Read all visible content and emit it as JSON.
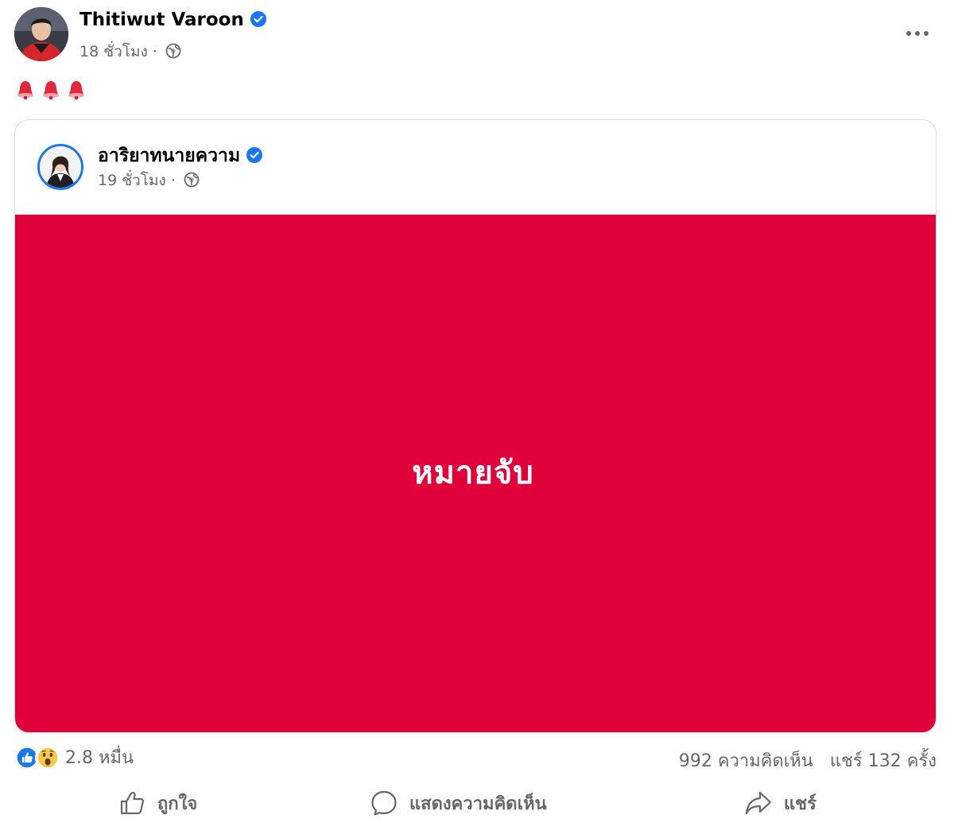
{
  "post": {
    "author_name": "Thitiwut Varoon",
    "time": "18 ชั่วโมง",
    "separator": "·",
    "caption_icons": [
      "red-bell-icon",
      "red-bell-icon",
      "red-bell-icon"
    ]
  },
  "shared": {
    "author_name": "อาริยาทนายความ",
    "time": "19 ชั่วโมง",
    "separator": "·",
    "banner_text": "หมายจับ",
    "banner_color": "#e0003a"
  },
  "stats": {
    "reactions": [
      "like-icon",
      "wow-icon"
    ],
    "reaction_count": "2.8 หมื่น",
    "comments": "992 ความคิดเห็น",
    "shares": "แชร์ 132 ครั้ง"
  },
  "actions": {
    "like": "ถูกใจ",
    "comment": "แสดงความคิดเห็น",
    "share": "แชร์"
  },
  "colors": {
    "verified": "#1877f2",
    "muted_text": "#65676b"
  }
}
